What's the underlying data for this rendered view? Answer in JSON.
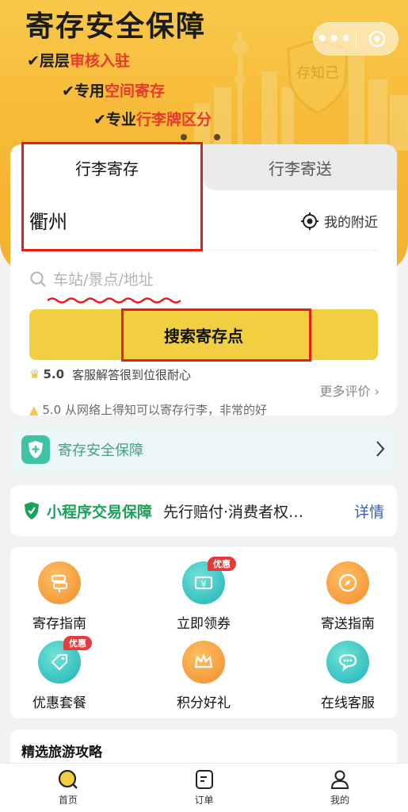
{
  "banner": {
    "title": "寄存安全保障",
    "line1_a": "层层",
    "line1_b": "审核入驻",
    "line2_a": "专用",
    "line2_b": "空间寄存",
    "line3_a": "专业",
    "line3_b": "行李牌区分",
    "shield_text": "存知己",
    "accent_color": "#e8392f"
  },
  "capsule": {
    "more": "•••",
    "icon": "target-icon"
  },
  "search": {
    "tab_active": "行李寄存",
    "tab_inactive": "行李寄送",
    "city": "衢州",
    "nearby": "我的附近",
    "placeholder": "车站/景点/地址",
    "button": "搜索寄存点",
    "button_color": "#f2cf40",
    "review1_score": "5.0",
    "review1_text": "客服解答很到位很耐心",
    "review2_text": "5.0 从网络上得知可以寄存行李，非常的好",
    "more_reviews": "更多评价"
  },
  "safety": {
    "label": "寄存安全保障"
  },
  "guarantee": {
    "title": "小程序交易保障",
    "desc": "先行赔付·消费者权…",
    "detail": "详情"
  },
  "grid": {
    "items": [
      {
        "label": "寄存指南",
        "icon": "signpost-icon"
      },
      {
        "label": "立即领券",
        "icon": "coupon-icon",
        "badge": "优惠"
      },
      {
        "label": "寄送指南",
        "icon": "compass-icon"
      },
      {
        "label": "优惠套餐",
        "icon": "tag-icon",
        "badge": "优惠"
      },
      {
        "label": "积分好礼",
        "icon": "crown-icon"
      },
      {
        "label": "在线客服",
        "icon": "chat-icon"
      }
    ]
  },
  "travel": {
    "title": "精选旅游攻略"
  },
  "nav": {
    "items": [
      {
        "label": "首页",
        "icon": "home-search-icon"
      },
      {
        "label": "订单",
        "icon": "order-icon"
      },
      {
        "label": "我的",
        "icon": "user-icon"
      }
    ]
  }
}
